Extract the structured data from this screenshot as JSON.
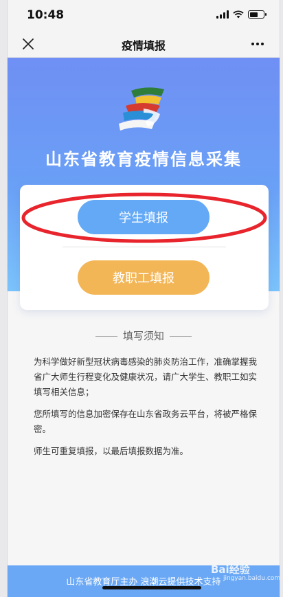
{
  "status_bar": {
    "time": "10:48"
  },
  "nav": {
    "title": "疫情填报"
  },
  "icons": {
    "close": "close-icon",
    "more": "more-icon",
    "logo": "logo-icon",
    "signal": "signal-icon",
    "wifi": "wifi-icon",
    "battery": "battery-icon"
  },
  "hero": {
    "title": "山东省教育疫情信息采集"
  },
  "card": {
    "student_button": "学生填报",
    "staff_button": "教职工填报"
  },
  "notice": {
    "heading": "填写须知",
    "paragraphs": [
      "为科学做好新型冠状病毒感染的肺炎防治工作，准确掌握我省广大师生行程变化及健康状况，请广大学生、教职工如实填写相关信息；",
      "您所填写的信息加密保存在山东省政务云平台，将被严格保密。",
      "师生可重复填报，以最后填报数据为准。"
    ]
  },
  "footer": {
    "text": "山东省教育厅主办 浪潮云提供技术支持"
  },
  "watermark": {
    "brand": "Bai经验",
    "url": "jingyan.baidu.com"
  },
  "colors": {
    "hero_top": "#6f8ff4",
    "hero_bottom": "#7bc3fb",
    "student_button": "#63a9f6",
    "staff_button": "#f3b657",
    "footer": "#6aa8f5",
    "highlight": "#e8242c"
  }
}
